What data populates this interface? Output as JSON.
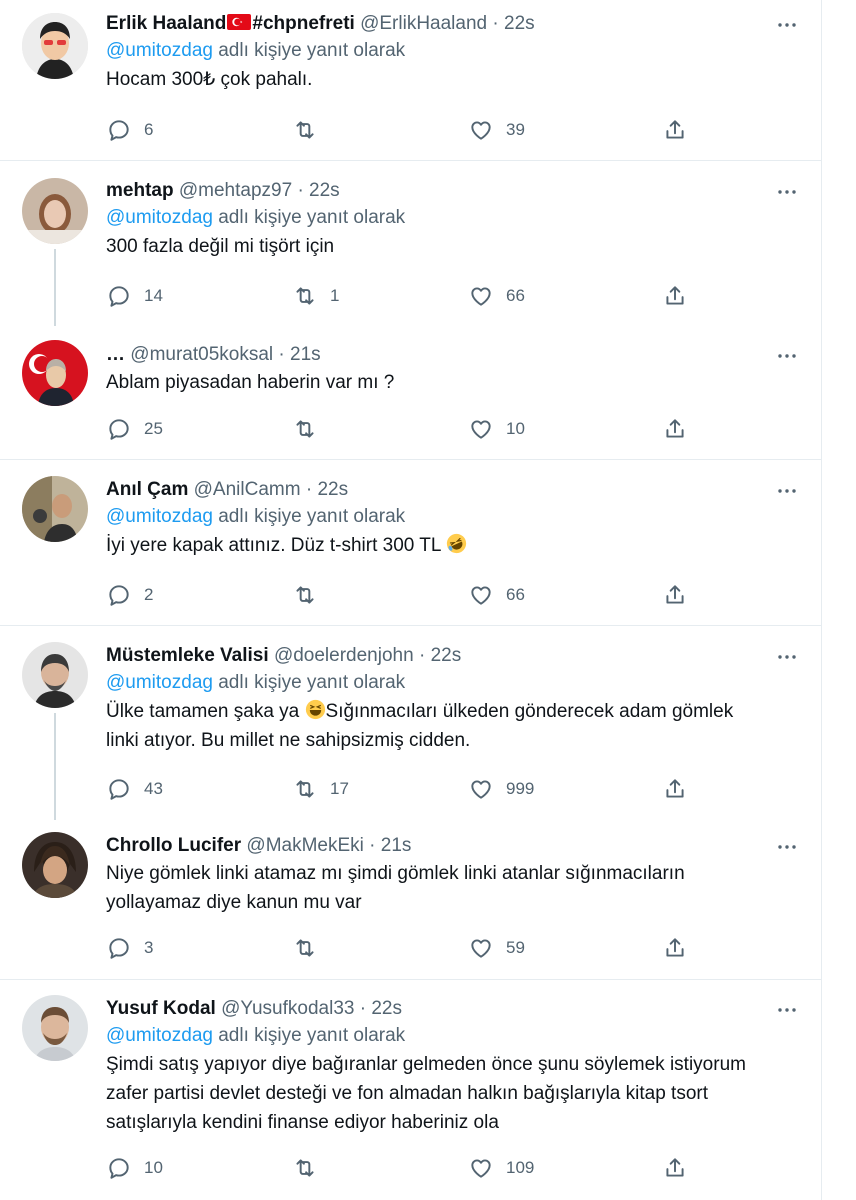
{
  "reply_prefix": "adlı kişiye yanıt olarak",
  "tweets": [
    {
      "name": "Erlik Haaland",
      "tag": "#chpnefreti",
      "handle": "@ErlikHaaland",
      "dot": "·",
      "time": "22s",
      "mention": "@umitozdag",
      "text": "Hocam 300₺ çok pahalı.",
      "replies": "6",
      "retweets": "",
      "likes": "39"
    },
    {
      "name": "mehtap",
      "handle": "@mehtapz97",
      "dot": "·",
      "time": "22s",
      "mention": "@umitozdag",
      "text": "300 fazla değil mi tişört için",
      "replies": "14",
      "retweets": "1",
      "likes": "66"
    },
    {
      "name": "…",
      "handle": "@murat05koksal",
      "dot": "·",
      "time": "21s",
      "text": "Ablam piyasadan haberin var mı ?",
      "replies": "25",
      "retweets": "",
      "likes": "10"
    },
    {
      "name": "Anıl Çam",
      "handle": "@AnilCamm",
      "dot": "·",
      "time": "22s",
      "mention": "@umitozdag",
      "text": "İyi yere kapak attınız. Düz t-shirt 300 TL",
      "replies": "2",
      "retweets": "",
      "likes": "66"
    },
    {
      "name": "Müstemleke Valisi",
      "handle": "@doelerdenjohn",
      "dot": "·",
      "time": "22s",
      "mention": "@umitozdag",
      "text_a": "Ülke tamamen şaka ya",
      "text_b": "Sığınmacıları ülkeden gönderecek adam gömlek",
      "text_c": "linki atıyor. Bu millet ne sahipsizmiş cidden.",
      "replies": "43",
      "retweets": "17",
      "likes": "999"
    },
    {
      "name": "Chrollo Lucifer",
      "handle": "@MakMekEki",
      "dot": "·",
      "time": "21s",
      "text_a": "Niye gömlek linki atamaz mı şimdi gömlek linki atanlar sığınmacıların",
      "text_b": "yollayamaz diye kanun mu var",
      "replies": "3",
      "retweets": "",
      "likes": "59"
    },
    {
      "name": "Yusuf Kodal",
      "handle": "@Yusufkodal33",
      "dot": "·",
      "time": "22s",
      "mention": "@umitozdag",
      "text_a": "Şimdi satış yapıyor diye bağıranlar gelmeden önce şunu söylemek istiyorum",
      "text_b": "zafer partisi devlet desteği ve fon almadan halkın bağışlarıyla kitap tsort",
      "text_c": "satışlarıyla kendini finanse ediyor haberiniz ola",
      "replies": "10",
      "retweets": "",
      "likes": "109"
    }
  ],
  "icons": {
    "reply": "reply-icon",
    "retweet": "retweet-icon",
    "like": "heart-icon",
    "share": "share-icon",
    "more": "more-icon"
  },
  "colors": {
    "mention": "#1d9bf0",
    "muted": "#536471",
    "text": "#0f1419",
    "divider": "#e6ecf0"
  }
}
